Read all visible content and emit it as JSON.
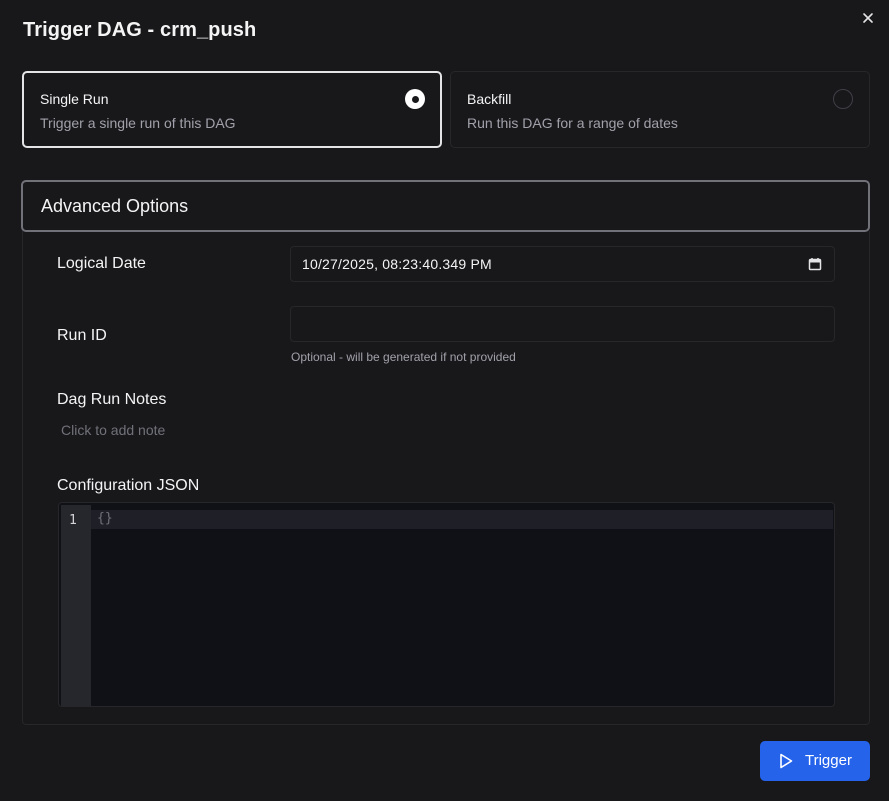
{
  "dialog": {
    "title": "Trigger DAG - crm_push",
    "close_icon": "close-icon"
  },
  "run_type": {
    "options": [
      {
        "label": "Single Run",
        "description": "Trigger a single run of this DAG",
        "selected": true
      },
      {
        "label": "Backfill",
        "description": "Run this DAG for a range of dates",
        "selected": false
      }
    ]
  },
  "advanced": {
    "header": "Advanced Options",
    "logical_date": {
      "label": "Logical Date",
      "value": "10/27/2025, 08:23:40.349 PM",
      "icon": "calendar-icon"
    },
    "run_id": {
      "label": "Run ID",
      "value": "",
      "helper": "Optional - will be generated if not provided"
    },
    "notes": {
      "label": "Dag Run Notes",
      "placeholder": "Click to add note"
    },
    "config": {
      "label": "Configuration JSON",
      "line_number": "1",
      "code": "{}"
    }
  },
  "footer": {
    "trigger_label": "Trigger",
    "trigger_icon": "play-icon",
    "accent": "#2563eb"
  }
}
